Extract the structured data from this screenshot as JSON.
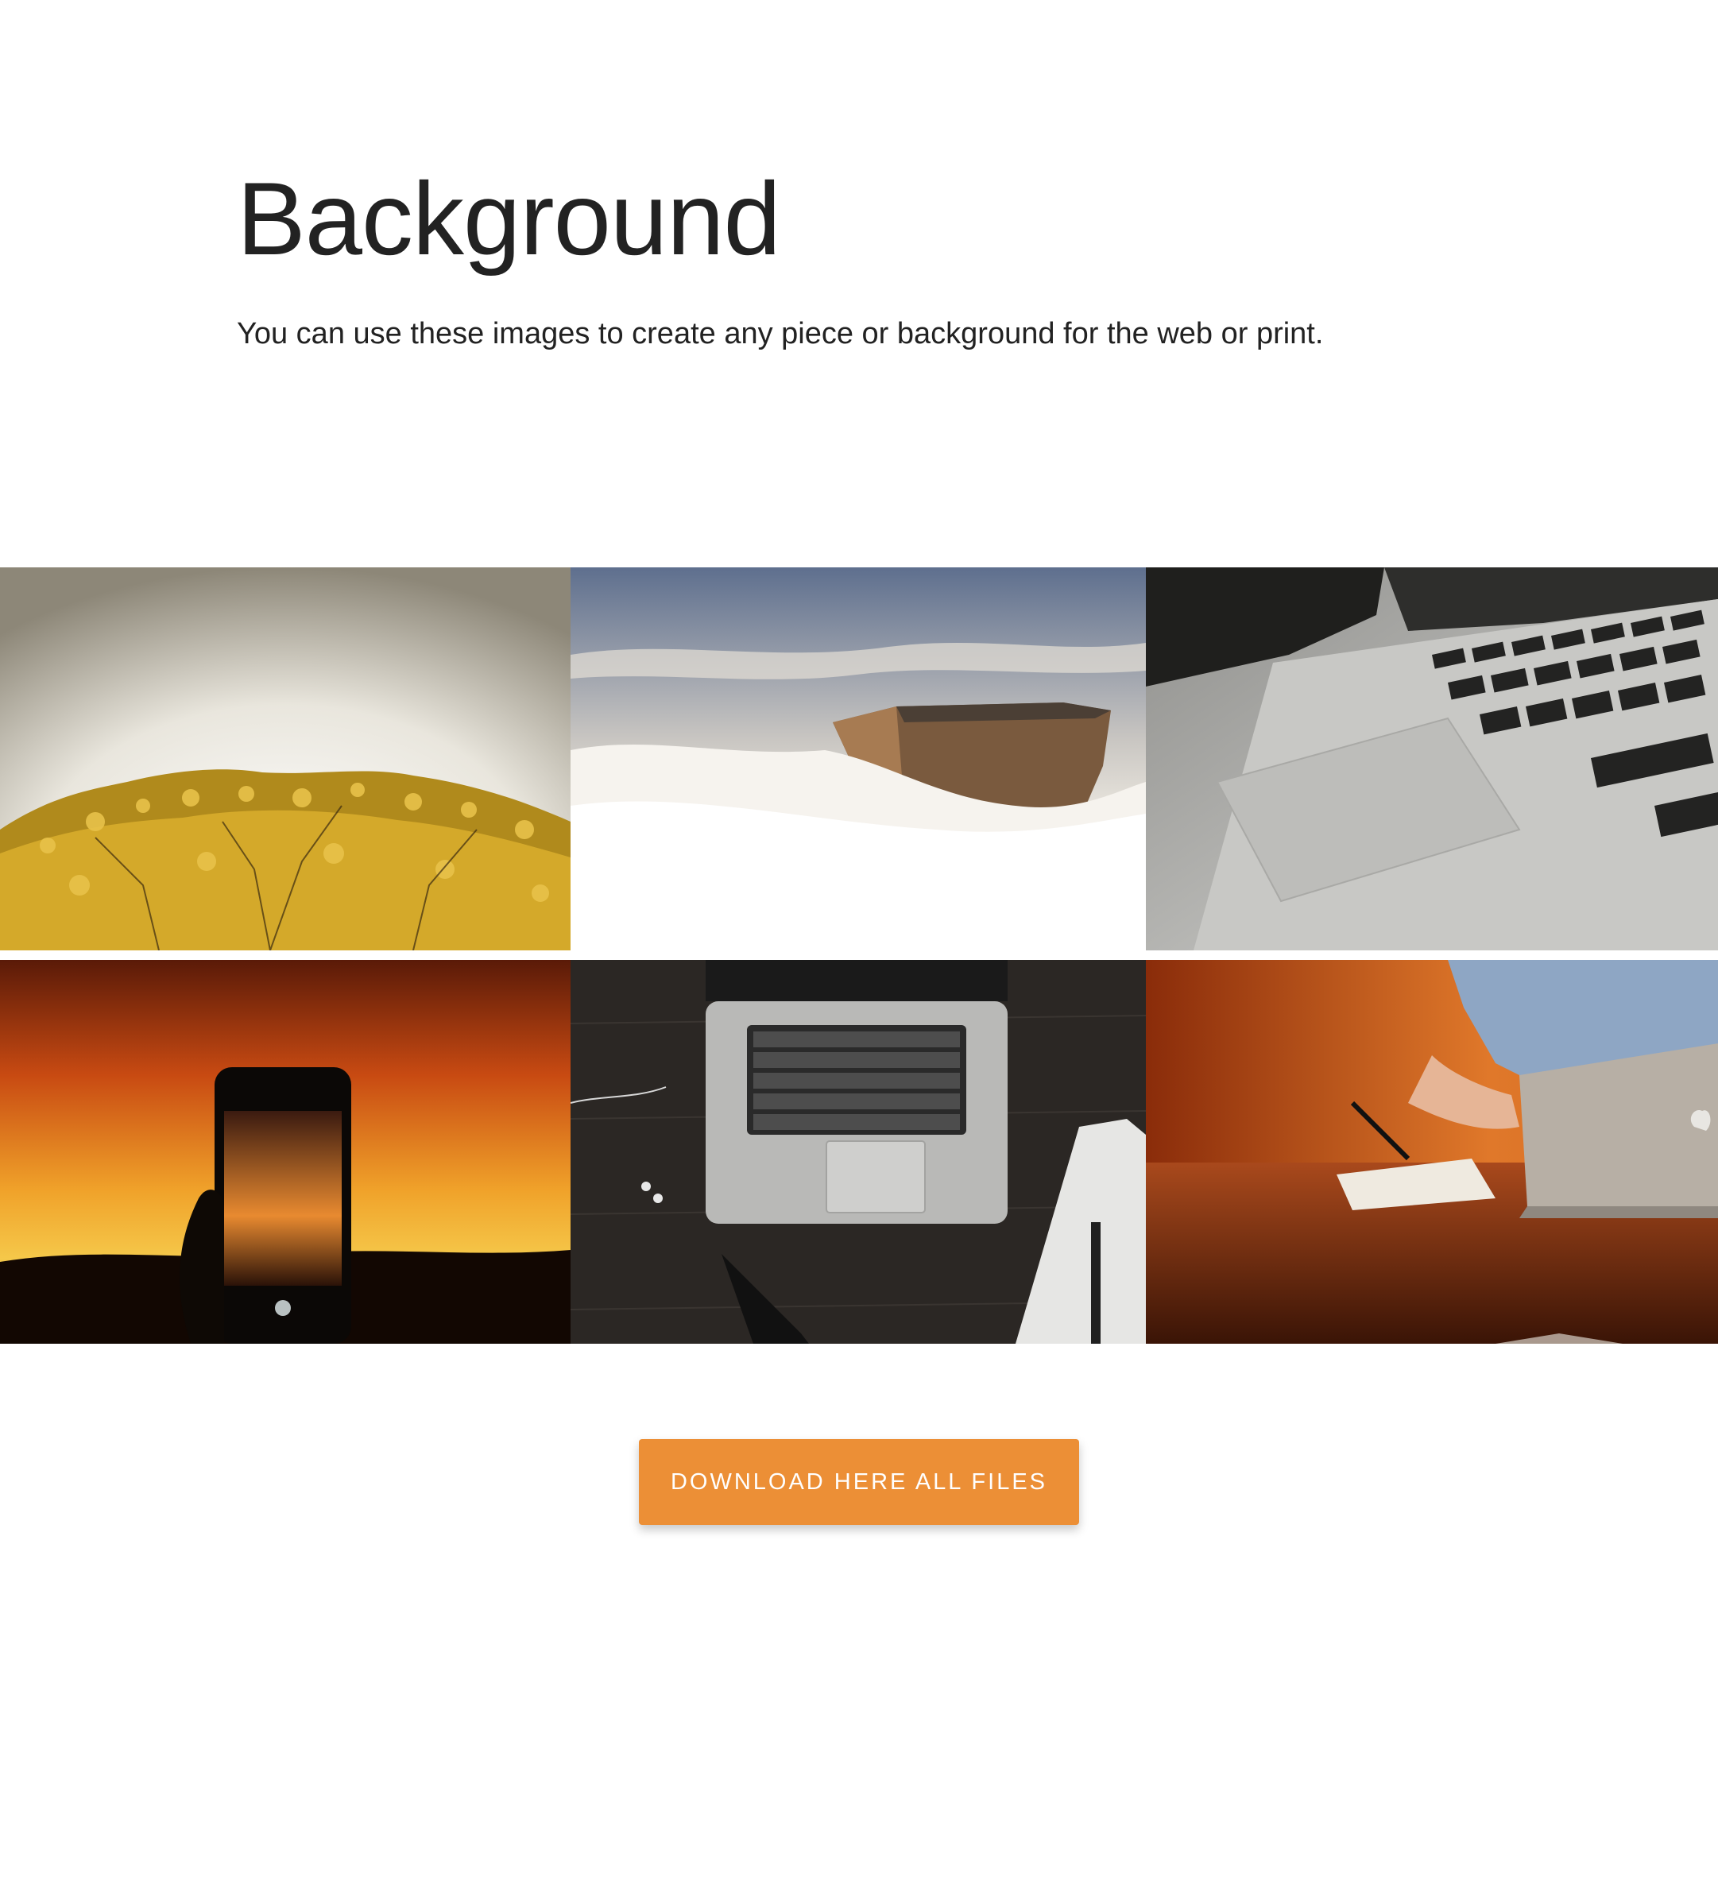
{
  "header": {
    "title": "Background",
    "subtitle": "You can use these images to create any piece or background for the web or print."
  },
  "gallery": {
    "images": [
      {
        "name": "yellow-blossom-tree"
      },
      {
        "name": "tepui-above-clouds"
      },
      {
        "name": "laptop-keyboard-closeup"
      },
      {
        "name": "phone-sunset-photo"
      },
      {
        "name": "laptop-on-dark-desk"
      },
      {
        "name": "writing-at-orange-desk"
      }
    ]
  },
  "actions": {
    "download_label": "Download here all files"
  },
  "colors": {
    "accent": "#ec8f36",
    "text": "#222222",
    "background": "#ffffff"
  }
}
